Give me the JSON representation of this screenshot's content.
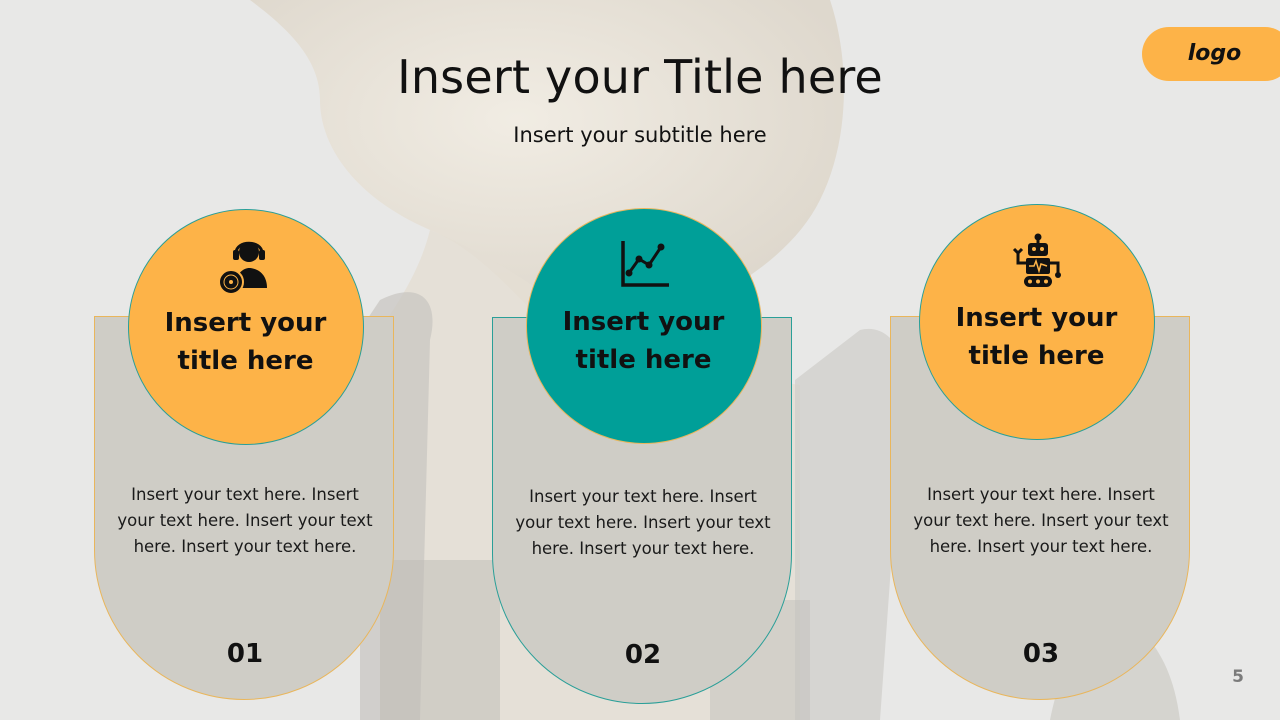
{
  "slide": {
    "title": "Insert your Title here",
    "subtitle": "Insert your subtitle here",
    "logo": "logo",
    "page_number": "5"
  },
  "cards": [
    {
      "title_line1": "Insert your",
      "title_line2": "title here",
      "text": "Insert your text here. Insert your text here. Insert your text here. Insert your text here.",
      "number": "01",
      "icon": "headphones-user-vinyl-icon",
      "color": "#fdb348"
    },
    {
      "title_line1": "Insert your",
      "title_line2": "title here",
      "text": "Insert your text here. Insert your text here. Insert your text here. Insert your text here.",
      "number": "02",
      "icon": "line-chart-icon",
      "color": "#009f98"
    },
    {
      "title_line1": "Insert your",
      "title_line2": "title here",
      "text": "Insert your text here. Insert your text here. Insert your text here. Insert your text here.",
      "number": "03",
      "icon": "robot-icon",
      "color": "#fdb348"
    }
  ],
  "colors": {
    "accent_orange": "#fdb348",
    "accent_teal": "#009f98",
    "card_fill": "#cfcdc6",
    "background": "#e9e9e9"
  }
}
